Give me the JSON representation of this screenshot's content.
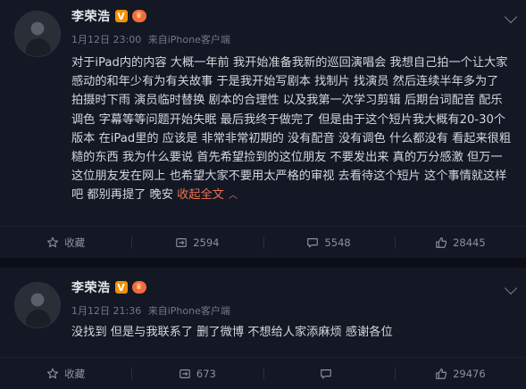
{
  "posts": [
    {
      "user": "李荣浩",
      "verified_badge": "V",
      "level_badge": "vip",
      "date": "1月12日 23:00",
      "source_prefix": "来自",
      "source": "iPhone客户端",
      "text": "对于iPad内的内容 大概一年前 我开始准备我新的巡回演唱会 我想自己拍一个让大家感动的和年少有为有关故事 于是我开始写剧本 找制片 找演员 然后连续半年多为了 拍摄时下雨 演员临时替换 剧本的合理性 以及我第一次学习剪辑 后期台词配音 配乐 调色 字幕等等问题开始失眠 最后我终于做完了 但是由于这个短片我大概有20-30个版本 在iPad里的 应该是 非常非常初期的 没有配音 没有调色 什么都没有 看起来很粗糙的东西 我为什么要说 首先希望捡到的这位朋友 不要发出来 真的万分感激 但万一这位朋友发在网上 也希望大家不要用太严格的审视 去看待这个短片 这个事情就这样吧 都别再提了 晚安 ",
      "more_label": "收起全文",
      "more_arrow": "︿",
      "actions": {
        "favorite": "收藏",
        "repost": "2594",
        "comment": "5548",
        "like": "28445"
      }
    },
    {
      "user": "李荣浩",
      "verified_badge": "V",
      "level_badge": "vip",
      "date": "1月12日 21:36",
      "source_prefix": "来自",
      "source": "iPhone客户端",
      "text": "没找到 但是与我联系了 删了微博 不想给人家添麻烦 感谢各位",
      "actions": {
        "favorite": "收藏",
        "repost": "673",
        "comment": "",
        "like": "29476"
      }
    }
  ],
  "colors": {
    "background": "#141824",
    "link": "#eb7350",
    "vbadge": "#f29100"
  }
}
